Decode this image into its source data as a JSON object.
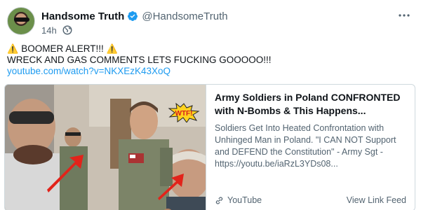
{
  "author": {
    "display_name": "Handsome Truth",
    "handle": "@HandsomeTruth",
    "verified": true
  },
  "meta": {
    "timestamp": "14h",
    "visibility_icon": "globe-icon"
  },
  "post": {
    "line1": "BOOMER ALERT!!!",
    "line2": "WRECK AND GAS COMMENTS LETS FUCKING GOOOOO!!!",
    "link": "youtube.com/watch?v=NKXEzK43XoQ",
    "warning_icon": "⚠️"
  },
  "card": {
    "thumbnail_badge": "WTF!",
    "title": "Army Soldiers in Poland CONFRONTED with N-Bombs & This Happens...",
    "description": "Soldiers Get Into Heated Confrontation with Unhinged Man in Poland. \"I CAN NOT Support and DEFEND the Constitution\" - Army Sgt - https://youtu.be/iaRzL3YDs08...",
    "source": "YouTube",
    "view_feed": "View Link Feed"
  },
  "colors": {
    "link": "#1d9bf0",
    "verified": "#1d9bf0",
    "muted": "#536471",
    "arrow": "#e2231a"
  }
}
